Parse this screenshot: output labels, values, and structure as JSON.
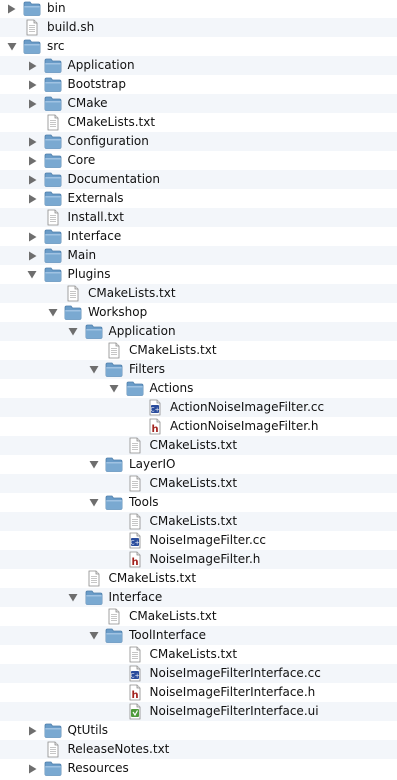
{
  "colors": {
    "row_alt": "#f3f6fa",
    "folder_blue": "#7aa9d1",
    "text": "#111111",
    "disclosure": "#6e6e6e"
  },
  "items": [
    {
      "name": "bin",
      "depth": 0,
      "kind": "folder",
      "state": "collapsed"
    },
    {
      "name": "build.sh",
      "depth": 0,
      "kind": "file-text"
    },
    {
      "name": "src",
      "depth": 0,
      "kind": "folder",
      "state": "expanded"
    },
    {
      "name": "Application",
      "depth": 1,
      "kind": "folder",
      "state": "collapsed"
    },
    {
      "name": "Bootstrap",
      "depth": 1,
      "kind": "folder",
      "state": "collapsed"
    },
    {
      "name": "CMake",
      "depth": 1,
      "kind": "folder",
      "state": "collapsed"
    },
    {
      "name": "CMakeLists.txt",
      "depth": 1,
      "kind": "file-text"
    },
    {
      "name": "Configuration",
      "depth": 1,
      "kind": "folder",
      "state": "collapsed"
    },
    {
      "name": "Core",
      "depth": 1,
      "kind": "folder",
      "state": "collapsed"
    },
    {
      "name": "Documentation",
      "depth": 1,
      "kind": "folder",
      "state": "collapsed"
    },
    {
      "name": "Externals",
      "depth": 1,
      "kind": "folder",
      "state": "collapsed"
    },
    {
      "name": "Install.txt",
      "depth": 1,
      "kind": "file-text"
    },
    {
      "name": "Interface",
      "depth": 1,
      "kind": "folder",
      "state": "collapsed"
    },
    {
      "name": "Main",
      "depth": 1,
      "kind": "folder",
      "state": "collapsed"
    },
    {
      "name": "Plugins",
      "depth": 1,
      "kind": "folder",
      "state": "expanded"
    },
    {
      "name": "CMakeLists.txt",
      "depth": 2,
      "kind": "file-text"
    },
    {
      "name": "Workshop",
      "depth": 2,
      "kind": "folder",
      "state": "expanded"
    },
    {
      "name": "Application",
      "depth": 3,
      "kind": "folder",
      "state": "expanded"
    },
    {
      "name": "CMakeLists.txt",
      "depth": 4,
      "kind": "file-text"
    },
    {
      "name": "Filters",
      "depth": 4,
      "kind": "folder",
      "state": "expanded"
    },
    {
      "name": "Actions",
      "depth": 5,
      "kind": "folder",
      "state": "expanded"
    },
    {
      "name": "ActionNoiseImageFilter.cc",
      "depth": 6,
      "kind": "file-cc"
    },
    {
      "name": "ActionNoiseImageFilter.h",
      "depth": 6,
      "kind": "file-h"
    },
    {
      "name": "CMakeLists.txt",
      "depth": 5,
      "kind": "file-text"
    },
    {
      "name": "LayerIO",
      "depth": 4,
      "kind": "folder",
      "state": "expanded"
    },
    {
      "name": "CMakeLists.txt",
      "depth": 5,
      "kind": "file-text"
    },
    {
      "name": "Tools",
      "depth": 4,
      "kind": "folder",
      "state": "expanded"
    },
    {
      "name": "CMakeLists.txt",
      "depth": 5,
      "kind": "file-text"
    },
    {
      "name": "NoiseImageFilter.cc",
      "depth": 5,
      "kind": "file-cc"
    },
    {
      "name": "NoiseImageFilter.h",
      "depth": 5,
      "kind": "file-h"
    },
    {
      "name": "CMakeLists.txt",
      "depth": 3,
      "kind": "file-text"
    },
    {
      "name": "Interface",
      "depth": 3,
      "kind": "folder",
      "state": "expanded"
    },
    {
      "name": "CMakeLists.txt",
      "depth": 4,
      "kind": "file-text"
    },
    {
      "name": "ToolInterface",
      "depth": 4,
      "kind": "folder",
      "state": "expanded"
    },
    {
      "name": "CMakeLists.txt",
      "depth": 5,
      "kind": "file-text"
    },
    {
      "name": "NoiseImageFilterInterface.cc",
      "depth": 5,
      "kind": "file-cc"
    },
    {
      "name": "NoiseImageFilterInterface.h",
      "depth": 5,
      "kind": "file-h"
    },
    {
      "name": "NoiseImageFilterInterface.ui",
      "depth": 5,
      "kind": "file-ui"
    },
    {
      "name": "QtUtils",
      "depth": 1,
      "kind": "folder",
      "state": "collapsed"
    },
    {
      "name": "ReleaseNotes.txt",
      "depth": 1,
      "kind": "file-text"
    },
    {
      "name": "Resources",
      "depth": 1,
      "kind": "folder",
      "state": "collapsed"
    }
  ]
}
